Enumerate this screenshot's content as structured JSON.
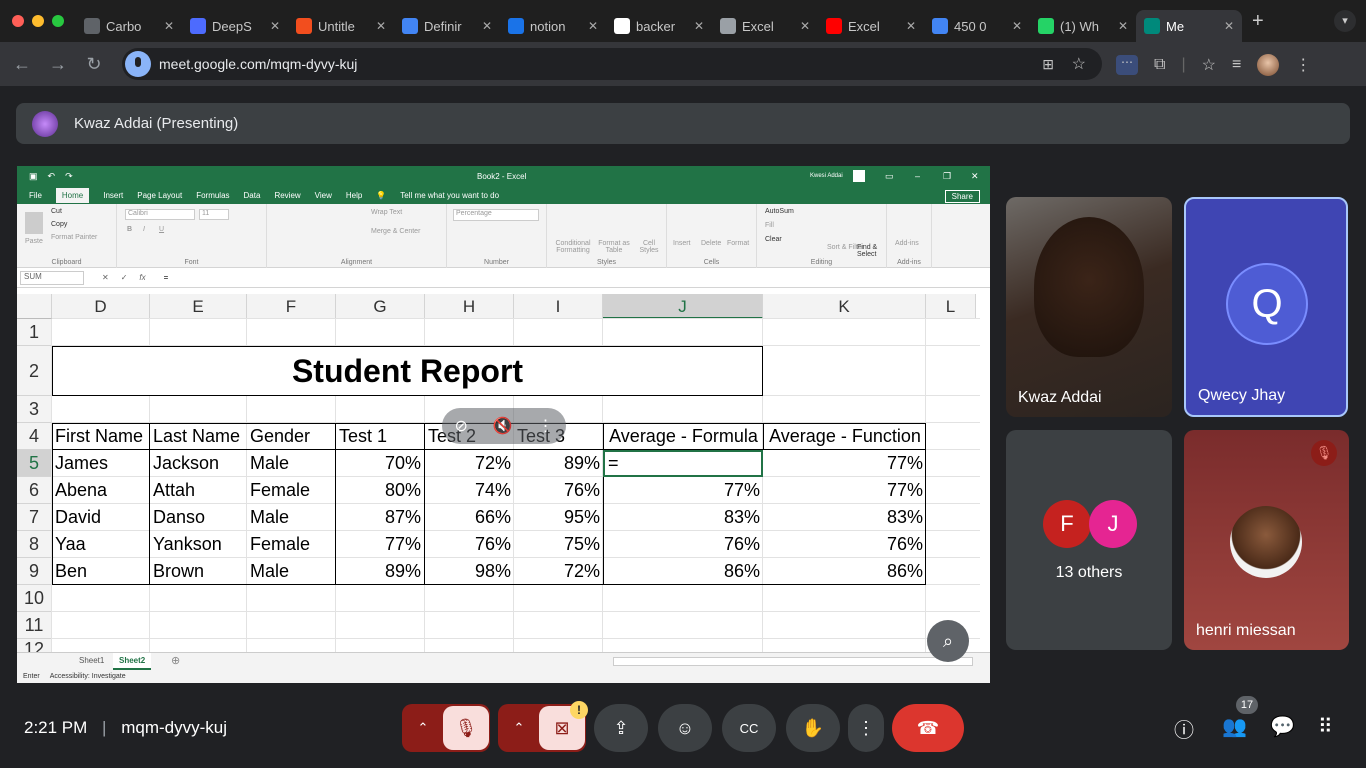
{
  "browser": {
    "tabs": [
      {
        "title": "Carbo",
        "color": "#5f6368"
      },
      {
        "title": "DeepS",
        "color": "#4d6bfe"
      },
      {
        "title": "Untitle",
        "color": "#f24e1e"
      },
      {
        "title": "Definir",
        "color": "#4285f4"
      },
      {
        "title": "notion",
        "color": "#1a73e8"
      },
      {
        "title": "backer",
        "color": "#ffffff"
      },
      {
        "title": "Excel",
        "color": "#9aa0a6"
      },
      {
        "title": "Excel",
        "color": "#ff0000"
      },
      {
        "title": "450 0",
        "color": "#4285f4"
      },
      {
        "title": "(1) Wh",
        "color": "#25d366"
      },
      {
        "title": "Me",
        "color": "#00897b",
        "active": true
      }
    ],
    "new_tab": "+",
    "url": "meet.google.com/mqm-dyvy-kuj"
  },
  "meet": {
    "presenter_label": "Kwaz Addai (Presenting)",
    "time": "2:21 PM",
    "meeting_code": "mqm-dyvy-kuj",
    "participants_count": "17",
    "tiles": {
      "kwaz": {
        "name": "Kwaz Addai"
      },
      "qwecy": {
        "name": "Qwecy Jhay",
        "initial": "Q"
      },
      "others": {
        "label": "13 others",
        "avatars": [
          "F",
          "J"
        ]
      },
      "henri": {
        "name": "henri miessan"
      }
    }
  },
  "excel": {
    "title": "Book2 - Excel",
    "user": "Kwesi Addai",
    "menu": [
      "File",
      "Home",
      "Insert",
      "Page Layout",
      "Formulas",
      "Data",
      "Review",
      "View",
      "Help"
    ],
    "tell_me": "Tell me what you want to do",
    "share": "Share",
    "ribbon": {
      "clipboard": {
        "label": "Clipboard",
        "paste": "Paste",
        "cut": "Cut",
        "copy": "Copy",
        "format_painter": "Format Painter"
      },
      "font": {
        "label": "Font",
        "name": "Calibri",
        "size": "11"
      },
      "alignment": {
        "label": "Alignment",
        "wrap": "Wrap Text",
        "merge": "Merge & Center"
      },
      "number": {
        "label": "Number",
        "format": "Percentage"
      },
      "styles": {
        "label": "Styles",
        "cond": "Conditional Formatting",
        "table": "Format as Table",
        "cell": "Cell Styles"
      },
      "cells": {
        "label": "Cells",
        "insert": "Insert",
        "delete": "Delete",
        "format": "Format"
      },
      "editing": {
        "label": "Editing",
        "autosum": "AutoSum",
        "fill": "Fill",
        "clear": "Clear",
        "sort": "Sort & Filter",
        "find": "Find & Select"
      },
      "addins": {
        "label": "Add-ins",
        "addins": "Add-ins"
      }
    },
    "namebox": "SUM",
    "formula": "=",
    "columns": [
      "D",
      "E",
      "F",
      "G",
      "H",
      "I",
      "J",
      "K",
      "L"
    ],
    "rows": [
      "1",
      "2",
      "3",
      "4",
      "5",
      "6",
      "7",
      "8",
      "9",
      "10",
      "11",
      "12"
    ],
    "report_title": "Student Report",
    "headers": [
      "First Name",
      "Last Name",
      "Gender",
      "Test 1",
      "Test 2",
      "Test 3",
      "Average - Formula",
      "Average - Function"
    ],
    "data": [
      [
        "James",
        "Jackson",
        "Male",
        "70%",
        "72%",
        "89%",
        "=",
        "77%"
      ],
      [
        "Abena",
        "Attah",
        "Female",
        "80%",
        "74%",
        "76%",
        "77%",
        "77%"
      ],
      [
        "David",
        "Danso",
        "Male",
        "87%",
        "66%",
        "95%",
        "83%",
        "83%"
      ],
      [
        "Yaa",
        "Yankson",
        "Female",
        "77%",
        "76%",
        "75%",
        "76%",
        "76%"
      ],
      [
        "Ben",
        "Brown",
        "Male",
        "89%",
        "98%",
        "72%",
        "86%",
        "86%"
      ]
    ],
    "sheets": [
      "Sheet1",
      "Sheet2"
    ],
    "active_sheet": "Sheet2",
    "status_mode": "Enter",
    "accessibility": "Accessibility: Investigate"
  }
}
